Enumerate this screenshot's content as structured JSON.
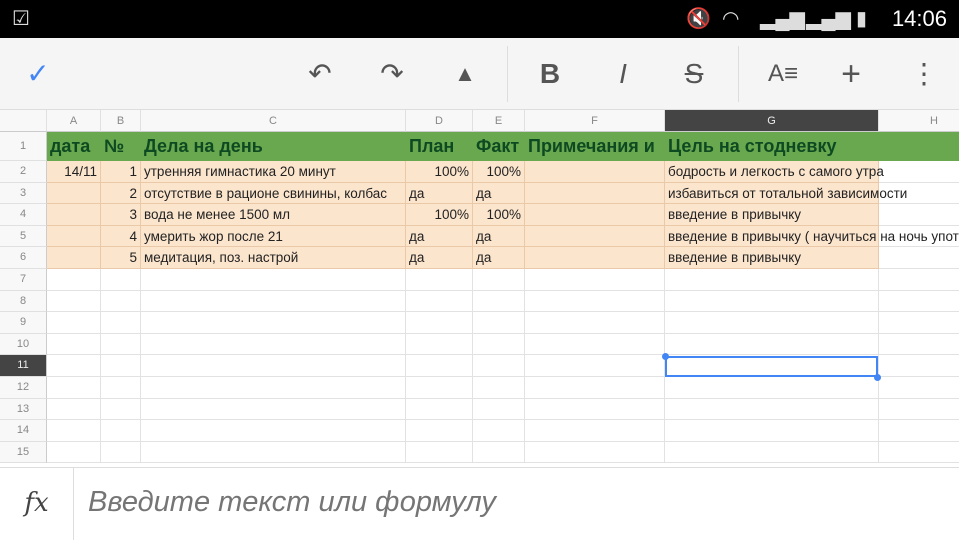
{
  "status": {
    "time": "14:06",
    "icons": [
      "clipboard-check-icon",
      "mute-icon",
      "wifi-icon",
      "signal-icon",
      "sim2-signal-icon",
      "battery-icon"
    ]
  },
  "toolbar": {
    "confirm": "✓",
    "undo": "↶",
    "redo": "↷",
    "fill": "▲",
    "bold": "B",
    "italic": "I",
    "strike": "S",
    "format": "A≡",
    "insert": "+",
    "more": "⋮"
  },
  "columns": [
    "A",
    "B",
    "C",
    "D",
    "E",
    "F",
    "G",
    "H"
  ],
  "rows": [
    "1",
    "2",
    "3",
    "4",
    "5",
    "6",
    "7",
    "8",
    "9",
    "10",
    "11",
    "12",
    "13",
    "14",
    "15"
  ],
  "selected": {
    "cell": "G11"
  },
  "header_row": [
    "дата",
    "№",
    "Дела на день",
    "План",
    "Факт",
    "Примечания и",
    "Цель на стодневку",
    ""
  ],
  "data": [
    [
      "14/11",
      "1",
      "утренняя гимнастика 20 минут",
      "100%",
      "100%",
      "",
      "бодрость и легкость с самого утра"
    ],
    [
      "",
      "2",
      "отсутствие в рационе свинины, колбас",
      "да",
      "да",
      "",
      "избавиться от тотальной зависимости"
    ],
    [
      "",
      "3",
      "вода не менее 1500 мл",
      "100%",
      "100%",
      "",
      "введение в привычку"
    ],
    [
      "",
      "4",
      "умерить жор после 21",
      "да",
      "да",
      "",
      "введение в привычку ( научиться на ночь упот"
    ],
    [
      "",
      "5",
      "медитация, поз. настрой",
      "да",
      "да",
      "",
      "введение в привычку"
    ]
  ],
  "formula_bar": {
    "label": "fx",
    "placeholder": "Введите текст или формулу"
  },
  "colors": {
    "header_fill": "#6aa84f",
    "header_text": "#0d4a22",
    "data_fill": "#fce5cd",
    "selection": "#4285f4"
  }
}
